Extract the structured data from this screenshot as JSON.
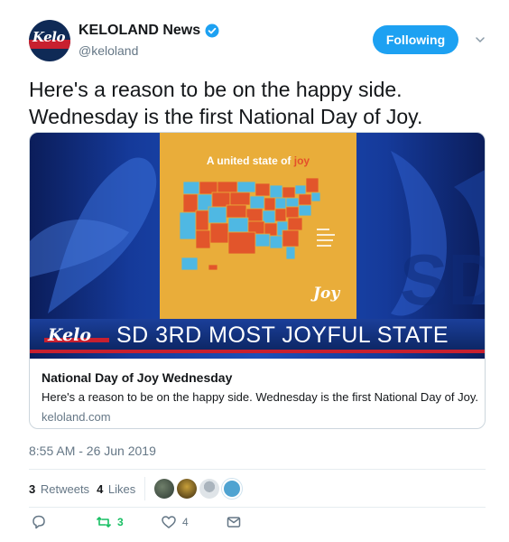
{
  "account": {
    "display_name": "KELOLAND News",
    "handle": "@keloland",
    "avatar_logo_text": "Kelo",
    "follow_button_label": "Following"
  },
  "tweet": {
    "text": "Here's a reason to be on the happy side. Wednesday is the first National Day of Joy."
  },
  "card": {
    "poster_title_prefix": "A united state of ",
    "poster_title_highlight": "joy",
    "poster_brand": "Joy",
    "banner_logo_text": "Kelo",
    "banner_text": "SD 3RD MOST JOYFUL STATE",
    "title": "National Day of Joy Wednesday",
    "description": "Here's a reason to be on the happy side. Wednesday is the first National Day of Joy.",
    "domain": "keloland.com"
  },
  "meta": {
    "timestamp": "8:55 AM - 26 Jun 2019",
    "retweets_count": "3",
    "retweets_label": "Retweets",
    "likes_count": "4",
    "likes_label": "Likes"
  },
  "actions": {
    "reply_count": "",
    "retweet_count": "3",
    "like_count": "4"
  },
  "colors": {
    "accent": "#1da1f2",
    "retweet_green": "#17bf63",
    "muted": "#657786"
  },
  "icons": {
    "verified": "verified-badge-icon",
    "caret": "chevron-down-icon",
    "reply": "reply-icon",
    "retweet": "retweet-icon",
    "like": "heart-icon",
    "dm": "envelope-icon"
  }
}
